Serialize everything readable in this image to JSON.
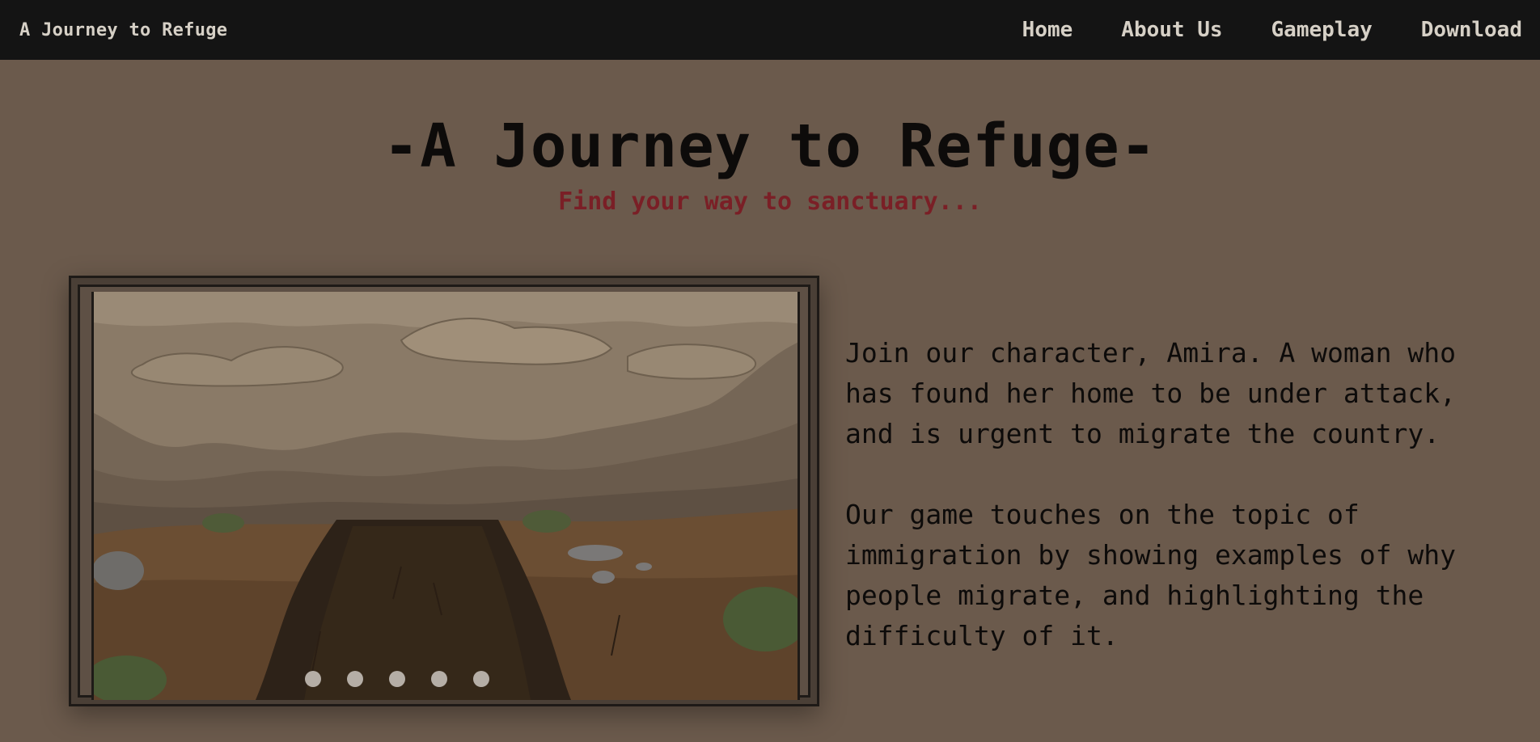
{
  "nav": {
    "brand": "A Journey to Refuge",
    "links": [
      "Home",
      "About Us",
      "Gameplay",
      "Download"
    ]
  },
  "hero": {
    "title": "-A Journey to Refuge-",
    "subtitle": "Find your way to sanctuary..."
  },
  "slideshow": {
    "dot_count": 5
  },
  "description": {
    "paragraphs": [
      "Join our character, Amira. A woman who has found her home to be under attack, and is urgent to migrate the country.",
      "Our game touches on the topic of immigration by showing examples of why people migrate, and highlighting the difficulty of it."
    ]
  },
  "colors": {
    "background": "#6b5a4c",
    "navbar": "#141414",
    "subtitle": "#7a1f26"
  }
}
